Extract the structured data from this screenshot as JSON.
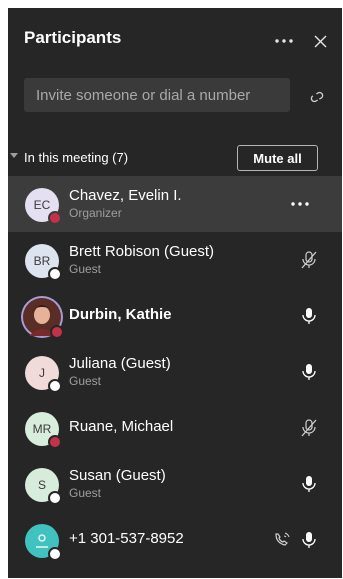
{
  "header": {
    "title": "Participants",
    "icons": {
      "more": "more-horizontal-icon",
      "close": "close-icon"
    }
  },
  "invite": {
    "placeholder": "Invite someone or dial a number",
    "link_icon": "link-icon"
  },
  "section": {
    "label": "In this meeting (7)",
    "mute_all_label": "Mute all"
  },
  "colors": {
    "panel_bg": "#262626",
    "highlight_bg": "#3c3c3c",
    "busy": "#c4314b",
    "text_secondary": "#9e9e9e"
  },
  "participants": [
    {
      "initials": "EC",
      "name": "Chavez, Evelin I.",
      "role": "Organizer",
      "avatar_color": "#e5dff2",
      "status": "busy",
      "action_icon": "more-horizontal-icon"
    },
    {
      "initials": "BR",
      "name": "Brett Robison (Guest)",
      "role": "Guest",
      "avatar_color": "#dde4f0",
      "status": "offline",
      "action_icon": "mic-off-icon"
    },
    {
      "initials": "",
      "name": "Durbin, Kathie",
      "role": "",
      "avatar_color": "#b06a5a",
      "status": "busy",
      "action_icon": "mic-icon"
    },
    {
      "initials": "J",
      "name": "Juliana (Guest)",
      "role": "Guest",
      "avatar_color": "#f1dada",
      "status": "offline",
      "action_icon": "mic-icon"
    },
    {
      "initials": "MR",
      "name": "Ruane, Michael",
      "role": "",
      "avatar_color": "#d8eddc",
      "status": "busy",
      "action_icon": "mic-off-icon"
    },
    {
      "initials": "S",
      "name": "Susan (Guest)",
      "role": "Guest",
      "avatar_color": "#d8ecdc",
      "status": "offline",
      "action_icon": "mic-icon"
    },
    {
      "initials": "",
      "name": "+1 301-537-8952",
      "role": "",
      "avatar_color": "#3fc2c0",
      "status": "offline",
      "action_icon": "mic-icon",
      "extra_icon": "phone-handset-icon"
    }
  ]
}
